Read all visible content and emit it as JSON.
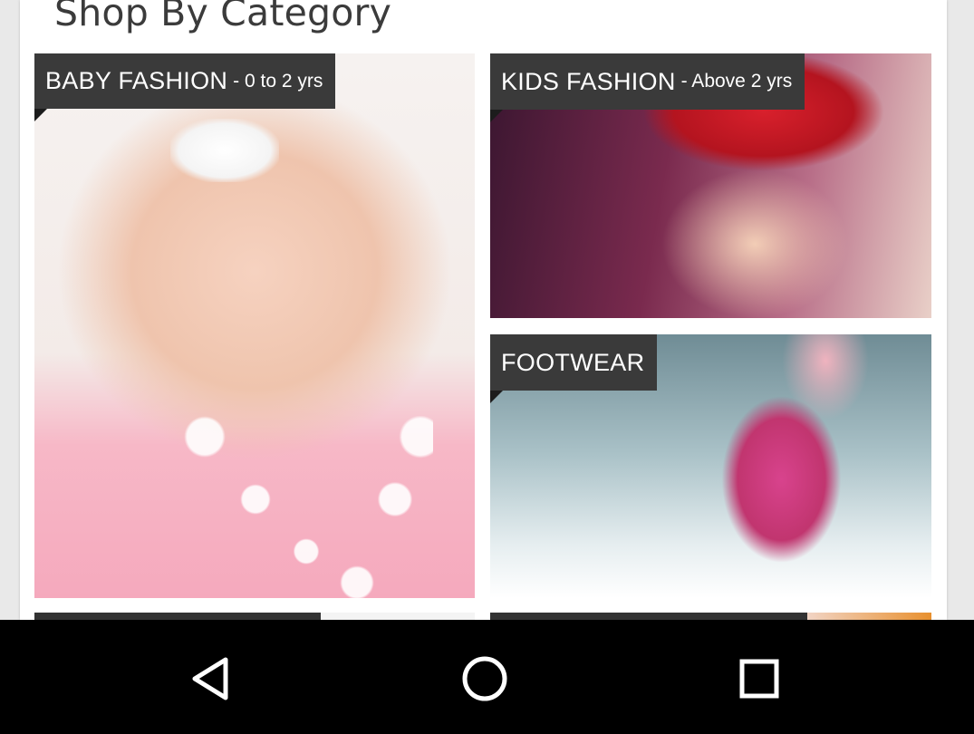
{
  "section": {
    "title": "Shop By Category"
  },
  "categories": [
    {
      "main": "BABY FASHION",
      "sub": "- 0 to 2 yrs"
    },
    {
      "main": "KIDS FASHION",
      "sub": "- Above 2 yrs"
    },
    {
      "main": "FOOTWEAR",
      "sub": ""
    }
  ],
  "navbar": {
    "back_icon": "back-triangle-icon",
    "home_icon": "home-circle-icon",
    "recents_icon": "recents-square-icon"
  },
  "colors": {
    "label_background": "#3a3a3a",
    "navbar_background": "#000000",
    "card_background": "#ffffff",
    "page_background": "#e9e9e9"
  }
}
